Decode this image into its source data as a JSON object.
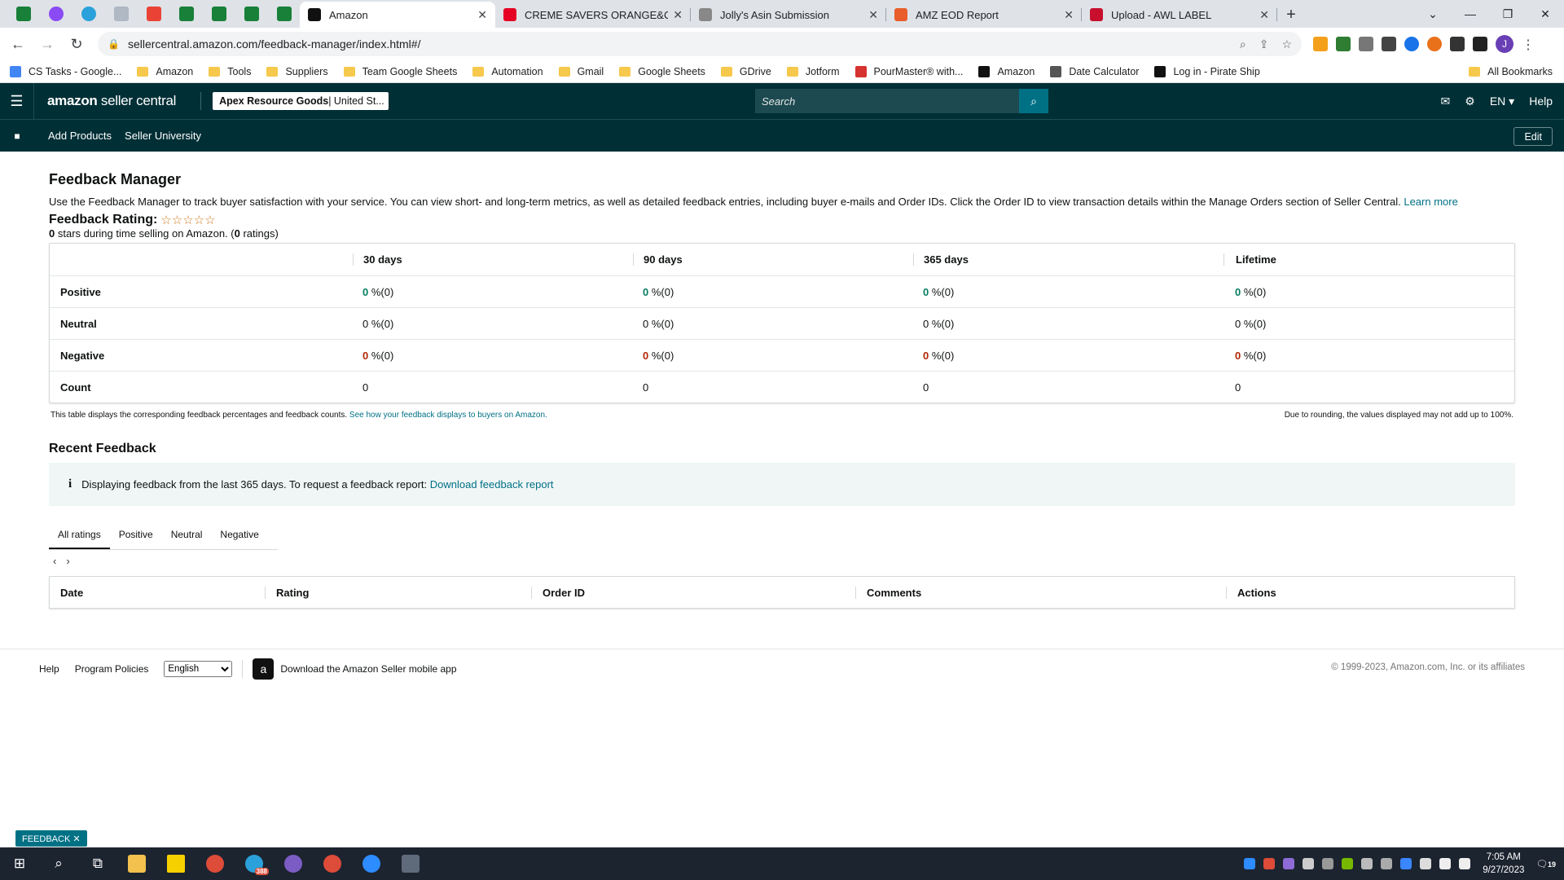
{
  "browser": {
    "tabs": [
      {
        "title": "Amazon",
        "color": "#111111",
        "active": true
      },
      {
        "title": "CREME SAVERS ORANGE&CREM",
        "color": "#e60023",
        "active": false
      },
      {
        "title": "Jolly's Asin Submission",
        "color": "#888888",
        "active": false
      },
      {
        "title": "AMZ EOD Report",
        "color": "#e85d2a",
        "active": false
      },
      {
        "title": "Upload - AWL LABEL",
        "color": "#c8102e",
        "active": false
      }
    ],
    "url": "sellercentral.amazon.com/feedback-manager/index.html#/",
    "bookmarks": [
      {
        "label": "CS Tasks - Google...",
        "type": "doc"
      },
      {
        "label": "Amazon",
        "type": "folder"
      },
      {
        "label": "Tools",
        "type": "folder"
      },
      {
        "label": "Suppliers",
        "type": "folder"
      },
      {
        "label": "Team Google Sheets",
        "type": "folder"
      },
      {
        "label": "Automation",
        "type": "folder"
      },
      {
        "label": "Gmail",
        "type": "folder"
      },
      {
        "label": "Google Sheets",
        "type": "folder"
      },
      {
        "label": "GDrive",
        "type": "folder"
      },
      {
        "label": "Jotform",
        "type": "folder"
      },
      {
        "label": "PourMaster® with...",
        "type": "site"
      },
      {
        "label": "Amazon",
        "type": "amazon"
      },
      {
        "label": "Date Calculator",
        "type": "calc"
      },
      {
        "label": "Log in - Pirate Ship",
        "type": "pirate"
      }
    ],
    "all_bookmarks": "All Bookmarks",
    "avatar_letter": "J"
  },
  "header": {
    "logo_bold": "amazon",
    "logo_rest": " seller central",
    "account_name": "Apex Resource Goods",
    "account_region": " | United St...",
    "search_placeholder": "Search",
    "lang": "EN ▾",
    "help": "Help",
    "nav": [
      "Add Products",
      "Seller University"
    ],
    "edit": "Edit"
  },
  "page": {
    "title": "Feedback Manager",
    "description": "Use the Feedback Manager to track buyer satisfaction with your service. You can view short- and long-term metrics, as well as detailed feedback entries, including buyer e-mails and Order IDs. Click the Order ID to view transaction details within the Manage Orders section of Seller Central.",
    "learn_more": "Learn more",
    "rating_label": "Feedback Rating:",
    "stars": "☆☆☆☆☆",
    "rating_stars_count": "0",
    "rating_sub_text": " stars during time selling on Amazon. (",
    "rating_count": "0",
    "rating_count_suffix": " ratings)"
  },
  "metrics": {
    "columns": [
      "30 days",
      "90 days",
      "365 days",
      "Lifetime"
    ],
    "rows": [
      {
        "label": "Positive",
        "style": "green",
        "cells": [
          {
            "num": "0",
            "rest": " %(0)"
          },
          {
            "num": "0",
            "rest": " %(0)"
          },
          {
            "num": "0",
            "rest": " %(0)"
          },
          {
            "num": "0",
            "rest": " %(0)"
          }
        ]
      },
      {
        "label": "Neutral",
        "style": "plain",
        "cells": [
          {
            "num": "0",
            "rest": " %(0)"
          },
          {
            "num": "0",
            "rest": " %(0)"
          },
          {
            "num": "0",
            "rest": " %(0)"
          },
          {
            "num": "0",
            "rest": " %(0)"
          }
        ]
      },
      {
        "label": "Negative",
        "style": "red",
        "cells": [
          {
            "num": "0",
            "rest": " %(0)"
          },
          {
            "num": "0",
            "rest": " %(0)"
          },
          {
            "num": "0",
            "rest": " %(0)"
          },
          {
            "num": "0",
            "rest": " %(0)"
          }
        ]
      },
      {
        "label": "Count",
        "style": "count",
        "cells": [
          {
            "num": "0",
            "rest": ""
          },
          {
            "num": "0",
            "rest": ""
          },
          {
            "num": "0",
            "rest": ""
          },
          {
            "num": "0",
            "rest": ""
          }
        ]
      }
    ],
    "note_left": "This table displays the corresponding feedback percentages and feedback counts.",
    "note_link": "See how your feedback displays to buyers on Amazon.",
    "note_right": "Due to rounding, the values displayed may not add up to 100%."
  },
  "recent": {
    "title": "Recent Feedback",
    "info": "Displaying feedback from the last 365 days. To request a feedback report:",
    "download_link": "Download feedback report",
    "tabs": [
      "All ratings",
      "Positive",
      "Neutral",
      "Negative"
    ],
    "active_tab": 0,
    "columns": [
      "Date",
      "Rating",
      "Order ID",
      "Comments",
      "Actions"
    ]
  },
  "footer": {
    "help": "Help",
    "policies": "Program Policies",
    "language": "English",
    "app": "Download the Amazon Seller mobile app",
    "copyright": "© 1999-2023, Amazon.com, Inc. or its affiliates"
  },
  "feedback_button": "FEEDBACK ✕",
  "taskbar": {
    "time": "7:05 AM",
    "date": "9/27/2023",
    "badge": "388",
    "notif": "19"
  }
}
